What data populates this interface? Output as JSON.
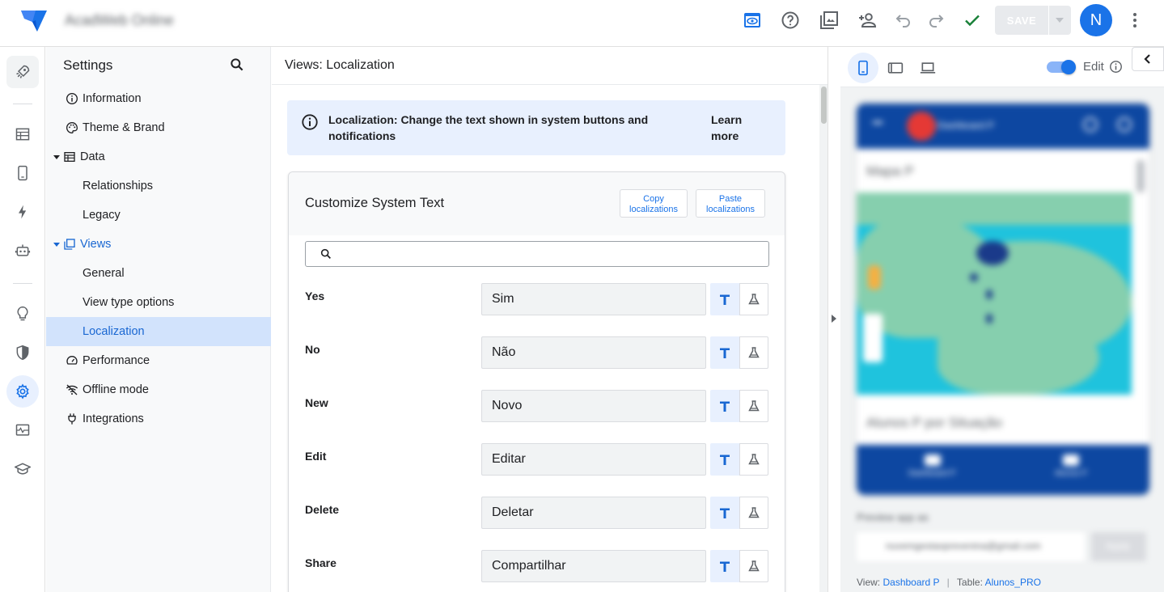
{
  "app": {
    "name": "AcadWeb Online"
  },
  "topbar": {
    "save_label": "SAVE",
    "avatar_initial": "N"
  },
  "settings": {
    "title": "Settings",
    "items": [
      {
        "label": "Information",
        "icon": "info-icon"
      },
      {
        "label": "Theme & Brand",
        "icon": "palette-icon"
      },
      {
        "label": "Data",
        "icon": "table-icon"
      },
      {
        "label": "Relationships"
      },
      {
        "label": "Legacy"
      },
      {
        "label": "Views",
        "icon": "views-icon"
      },
      {
        "label": "General"
      },
      {
        "label": "View type options"
      },
      {
        "label": "Localization"
      },
      {
        "label": "Performance",
        "icon": "speed-icon"
      },
      {
        "label": "Offline mode",
        "icon": "wifi-off-icon"
      },
      {
        "label": "Integrations",
        "icon": "plug-icon"
      }
    ]
  },
  "main": {
    "title": "Views: Localization",
    "info_text": "Localization: Change the text shown in system buttons and notifications",
    "info_link": "Learn more",
    "card_title": "Customize System Text",
    "copy_label": "Copy localizations",
    "paste_label": "Paste localizations",
    "search_value": "",
    "rows": [
      {
        "label": "Yes",
        "value": "Sim"
      },
      {
        "label": "No",
        "value": "Não"
      },
      {
        "label": "New",
        "value": "Novo"
      },
      {
        "label": "Edit",
        "value": "Editar"
      },
      {
        "label": "Delete",
        "value": "Deletar"
      },
      {
        "label": "Share",
        "value": "Compartilhar"
      }
    ]
  },
  "preview": {
    "edit_label": "Edit",
    "phone_title": "Dashboard P",
    "map_title": "Mapa P",
    "chart_title": "Alunos P por Situação",
    "footer_tab1": "Dashboard P",
    "footer_tab2": "Alunos P",
    "preview_as": "Preview app as",
    "preview_email": "nuvemgestaoprevenina@gmail.com",
    "apply_label": "Apply",
    "status_view_label": "View:",
    "status_view_value": "Dashboard P",
    "status_table_label": "Table:",
    "status_table_value": "Alunos_PRO"
  },
  "colors": {
    "accent": "#1a73e8",
    "active_nav_bg": "#d2e3fc",
    "info_bg": "#e8f0fe",
    "check": "#188038",
    "phone_bar": "#0d47a1"
  }
}
